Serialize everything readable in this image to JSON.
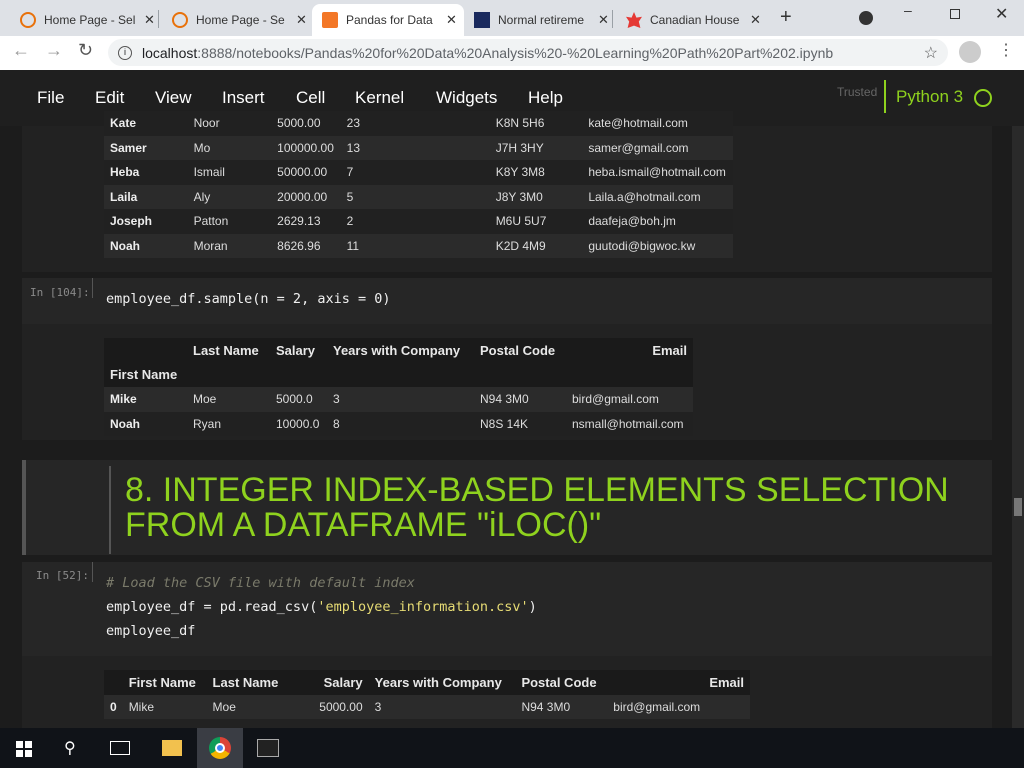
{
  "browser": {
    "tabs": [
      {
        "title": "Home Page - Sel",
        "icon": "loading-ring-icon"
      },
      {
        "title": "Home Page - Se",
        "icon": "loading-ring-icon"
      },
      {
        "title": "Pandas for Data",
        "icon": "jupyter-book-icon",
        "active": true
      },
      {
        "title": "Normal retireme",
        "icon": "ssa-logo-icon"
      },
      {
        "title": "Canadian House",
        "icon": "maple-leaf-icon"
      }
    ],
    "url_host": "localhost",
    "url_rest": ":8888/notebooks/Pandas%20for%20Data%20Analysis%20-%20Learning%20Path%20Part%202.ipynb"
  },
  "notebook": {
    "menu": [
      "File",
      "Edit",
      "View",
      "Insert",
      "Cell",
      "Kernel",
      "Widgets",
      "Help"
    ],
    "trusted": "Trusted",
    "kernel": "Python 3",
    "accent": "#8fd21e"
  },
  "table1": {
    "rows": [
      [
        "Kate",
        "Noor",
        "5000.00",
        "23",
        "K8N 5H6",
        "kate@hotmail.com"
      ],
      [
        "Samer",
        "Mo",
        "100000.00",
        "13",
        "J7H 3HY",
        "samer@gmail.com"
      ],
      [
        "Heba",
        "Ismail",
        "50000.00",
        "7",
        "K8Y 3M8",
        "heba.ismail@hotmail.com"
      ],
      [
        "Laila",
        "Aly",
        "20000.00",
        "5",
        "J8Y 3M0",
        "Laila.a@hotmail.com"
      ],
      [
        "Joseph",
        "Patton",
        "2629.13",
        "2",
        "M6U 5U7",
        "daafeja@boh.jm"
      ],
      [
        "Noah",
        "Moran",
        "8626.96",
        "11",
        "K2D 4M9",
        "guutodi@bigwoc.kw"
      ]
    ]
  },
  "cell1": {
    "prompt": "In [104]:",
    "code": "employee_df.sample(n = 2, axis = 0)"
  },
  "table2": {
    "headers": [
      "",
      "Last Name",
      "Salary",
      "Years with Company",
      "Postal Code",
      "Email"
    ],
    "index_name": "First Name",
    "rows": [
      [
        "Mike",
        "Moe",
        "5000.0",
        "3",
        "N94 3M0",
        "bird@gmail.com"
      ],
      [
        "Noah",
        "Ryan",
        "10000.0",
        "8",
        "N8S 14K",
        "nsmall@hotmail.com"
      ]
    ]
  },
  "markdown": {
    "heading": "8. INTEGER INDEX-BASED ELEMENTS SELECTION FROM A DATAFRAME \"iLOC()\""
  },
  "cell2": {
    "prompt": "In [52]:",
    "comment": "# Load the CSV file with default index",
    "line2a": "employee_df = pd.read_csv(",
    "line2s": "'employee_information.csv'",
    "line2b": ")",
    "line3": "employee_df"
  },
  "table3": {
    "headers": [
      "",
      "First Name",
      "Last Name",
      "Salary",
      "Years with Company",
      "Postal Code",
      "Email"
    ],
    "rows": [
      [
        "0",
        "Mike",
        "Moe",
        "5000.00",
        "3",
        "N94 3M0",
        "bird@gmail.com"
      ]
    ]
  }
}
